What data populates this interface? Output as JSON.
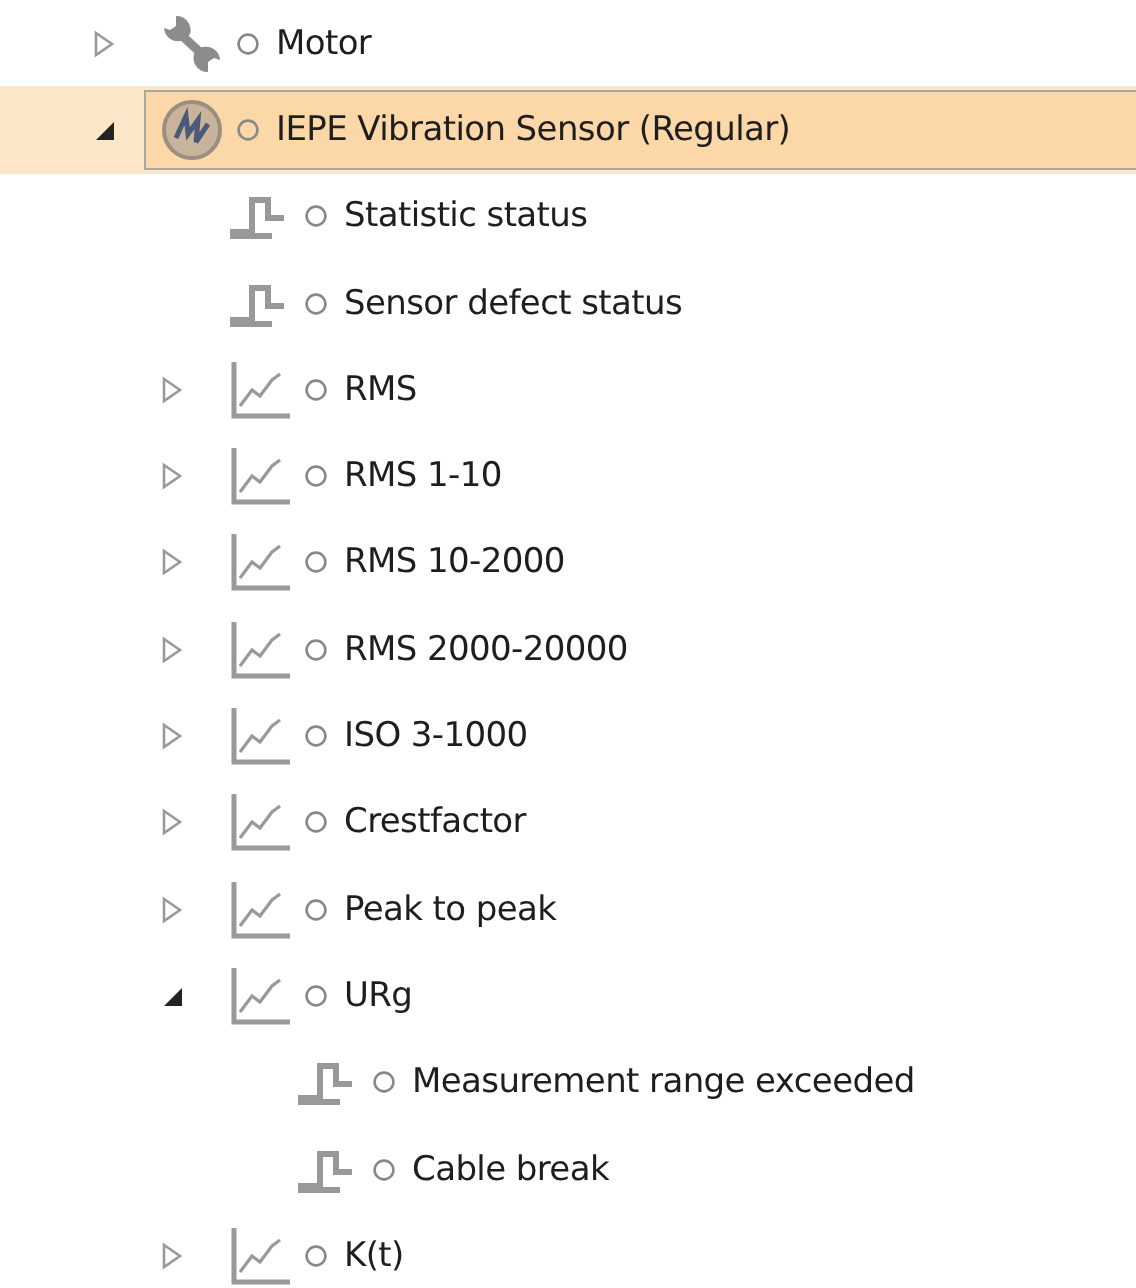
{
  "tree": [
    {
      "label": "Motor",
      "kind": "wrench",
      "expanded": false,
      "selected": false
    },
    {
      "label": "IEPE Vibration Sensor (Regular)",
      "kind": "sensor",
      "expanded": true,
      "selected": true,
      "children": [
        {
          "label": "Statistic status",
          "kind": "status",
          "selected": false
        },
        {
          "label": "Sensor defect status",
          "kind": "status",
          "selected": false
        },
        {
          "label": "RMS",
          "kind": "chart",
          "expanded": false,
          "selected": false
        },
        {
          "label": "RMS 1-10",
          "kind": "chart",
          "expanded": false,
          "selected": false
        },
        {
          "label": "RMS 10-2000",
          "kind": "chart",
          "expanded": false,
          "selected": false
        },
        {
          "label": "RMS 2000-20000",
          "kind": "chart",
          "expanded": false,
          "selected": false
        },
        {
          "label": "ISO 3-1000",
          "kind": "chart",
          "expanded": false,
          "selected": false
        },
        {
          "label": "Crestfactor",
          "kind": "chart",
          "expanded": false,
          "selected": false
        },
        {
          "label": "Peak to peak",
          "kind": "chart",
          "expanded": false,
          "selected": false
        },
        {
          "label": "URg",
          "kind": "chart",
          "expanded": true,
          "selected": false,
          "children": [
            {
              "label": "Measurement range exceeded",
              "kind": "status",
              "selected": false
            },
            {
              "label": "Cable break",
              "kind": "status",
              "selected": false
            }
          ]
        },
        {
          "label": "K(t)",
          "kind": "chart",
          "expanded": false,
          "selected": false
        }
      ]
    }
  ]
}
